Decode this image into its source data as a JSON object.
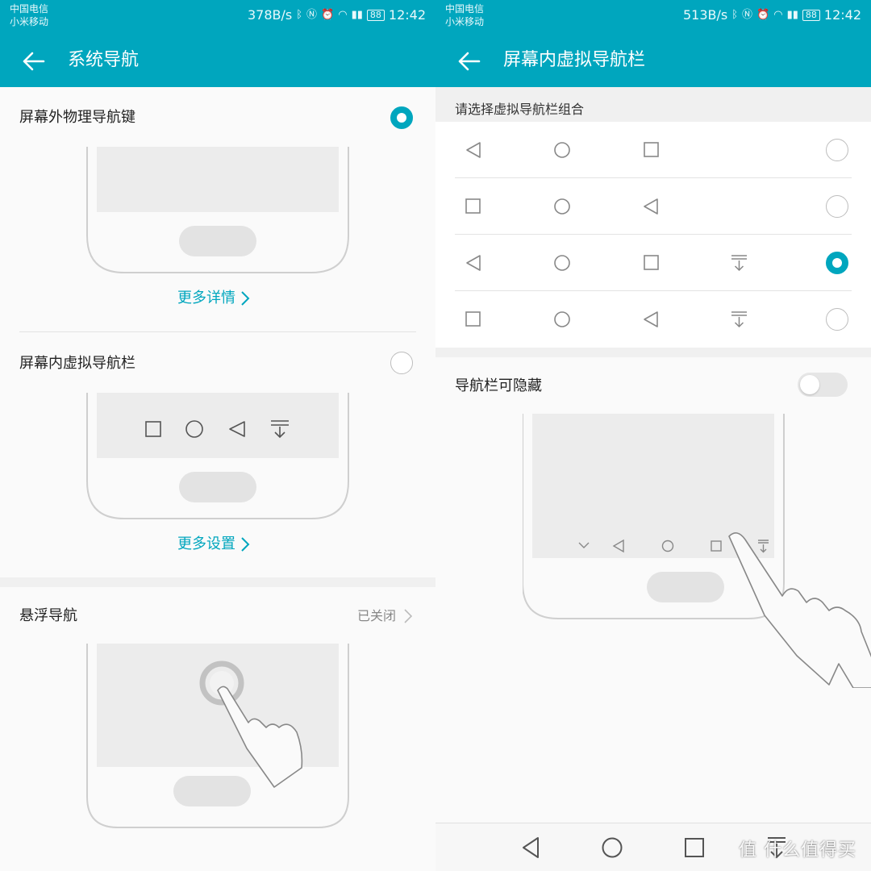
{
  "left": {
    "status": {
      "carrier1": "中国电信",
      "carrier2": "小米移动",
      "speed": "378B/s",
      "battery": "88",
      "time": "12:42"
    },
    "title": "系统导航",
    "options": [
      {
        "label": "屏幕外物理导航键",
        "selected": true,
        "link": "更多详情"
      },
      {
        "label": "屏幕内虚拟导航栏",
        "selected": false,
        "link": "更多设置"
      }
    ],
    "floating": {
      "label": "悬浮导航",
      "status": "已关闭"
    }
  },
  "right": {
    "status": {
      "carrier1": "中国电信",
      "carrier2": "小米移动",
      "speed": "513B/s",
      "battery": "88",
      "time": "12:42"
    },
    "title": "屏幕内虚拟导航栏",
    "subtitle": "请选择虚拟导航栏组合",
    "combos": [
      {
        "keys": [
          "back-icon",
          "home-icon",
          "recent-icon"
        ],
        "selected": false
      },
      {
        "keys": [
          "recent-icon",
          "home-icon",
          "back-icon"
        ],
        "selected": false
      },
      {
        "keys": [
          "back-icon",
          "home-icon",
          "recent-icon",
          "notification-pulldown-icon"
        ],
        "selected": true
      },
      {
        "keys": [
          "recent-icon",
          "home-icon",
          "back-icon",
          "notification-pulldown-icon"
        ],
        "selected": false
      }
    ],
    "hide_toggle": {
      "label": "导航栏可隐藏",
      "on": false
    },
    "navbar": [
      "back-icon",
      "home-icon",
      "recent-icon",
      "notification-pulldown-icon"
    ],
    "watermark": "值 什么值得买"
  },
  "colors": {
    "accent": "#00a6be"
  }
}
